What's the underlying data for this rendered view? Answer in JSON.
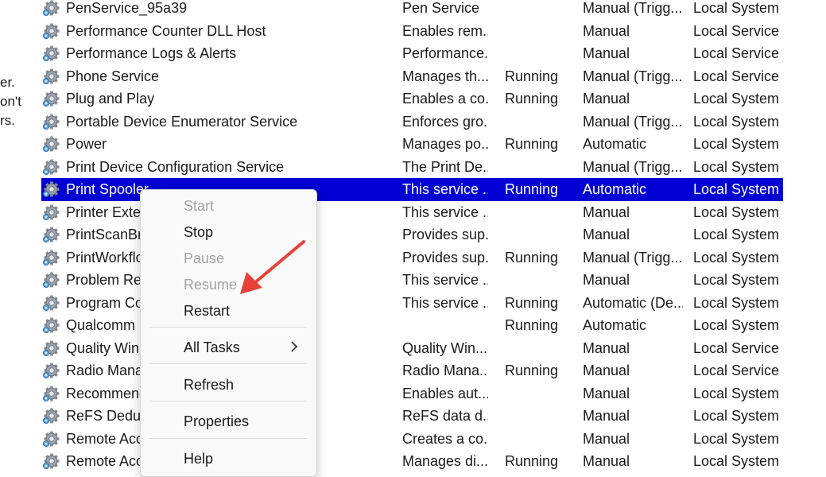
{
  "left_pane": {
    "fragments": [
      "er.",
      "on't",
      "rs."
    ]
  },
  "services": [
    {
      "name": "PenService_95a39",
      "description": "Pen Service",
      "status": "",
      "startup": "Manual (Trigg...",
      "logon": "Local System"
    },
    {
      "name": "Performance Counter DLL Host",
      "description": "Enables rem...",
      "status": "",
      "startup": "Manual",
      "logon": "Local Service"
    },
    {
      "name": "Performance Logs & Alerts",
      "description": "Performance...",
      "status": "",
      "startup": "Manual",
      "logon": "Local Service"
    },
    {
      "name": "Phone Service",
      "description": "Manages th...",
      "status": "Running",
      "startup": "Manual (Trigg...",
      "logon": "Local Service"
    },
    {
      "name": "Plug and Play",
      "description": "Enables a co...",
      "status": "Running",
      "startup": "Manual",
      "logon": "Local System"
    },
    {
      "name": "Portable Device Enumerator Service",
      "description": "Enforces gro...",
      "status": "",
      "startup": "Manual (Trigg...",
      "logon": "Local System"
    },
    {
      "name": "Power",
      "description": "Manages po...",
      "status": "Running",
      "startup": "Automatic",
      "logon": "Local System"
    },
    {
      "name": "Print Device Configuration Service",
      "description": "The Print De...",
      "status": "",
      "startup": "Manual (Trigg...",
      "logon": "Local System"
    },
    {
      "name": "Print Spooler",
      "description": "This service ...",
      "status": "Running",
      "startup": "Automatic",
      "logon": "Local System",
      "selected": true
    },
    {
      "name": "Printer Exter",
      "description": "This service ...",
      "status": "",
      "startup": "Manual",
      "logon": "Local System"
    },
    {
      "name": "PrintScanBro",
      "description": "Provides sup...",
      "status": "",
      "startup": "Manual",
      "logon": "Local System"
    },
    {
      "name": "PrintWorkflo",
      "description": "Provides sup...",
      "status": "Running",
      "startup": "Manual (Trigg...",
      "logon": "Local System"
    },
    {
      "name": "Problem Rep",
      "description": "This service ...",
      "status": "",
      "startup": "Manual",
      "logon": "Local System"
    },
    {
      "name": "Program Co",
      "description": "This service ...",
      "status": "Running",
      "startup": "Automatic (De...",
      "logon": "Local System"
    },
    {
      "name": "Qualcomm",
      "description": "",
      "status": "Running",
      "startup": "Automatic",
      "logon": "Local System"
    },
    {
      "name": "Quality Win                        e",
      "description": "Quality Win...",
      "status": "",
      "startup": "Manual",
      "logon": "Local Service"
    },
    {
      "name": "Radio Mana",
      "description": "Radio Mana...",
      "status": "Running",
      "startup": "Manual",
      "logon": "Local Service"
    },
    {
      "name": "Recommenc",
      "description": "Enables aut...",
      "status": "",
      "startup": "Manual",
      "logon": "Local System"
    },
    {
      "name": "ReFS Dedup",
      "description": "ReFS data d...",
      "status": "",
      "startup": "Manual",
      "logon": "Local System"
    },
    {
      "name": "Remote Acc                        er",
      "description": "Creates a co...",
      "status": "",
      "startup": "Manual",
      "logon": "Local System"
    },
    {
      "name": "Remote Acc",
      "description": "Manages di...",
      "status": "Running",
      "startup": "Manual",
      "logon": "Local System"
    }
  ],
  "context_menu": {
    "start": "Start",
    "stop": "Stop",
    "pause": "Pause",
    "resume": "Resume",
    "restart": "Restart",
    "all_tasks": "All Tasks",
    "refresh": "Refresh",
    "properties": "Properties",
    "help": "Help"
  },
  "icons": {
    "service": "gear-icon",
    "submenu": "chevron-right-icon",
    "annotation": "red-arrow"
  },
  "colors": {
    "selection": "#0000d4",
    "arrow": "#e8413a",
    "disabled_text": "#a2a2a2"
  }
}
